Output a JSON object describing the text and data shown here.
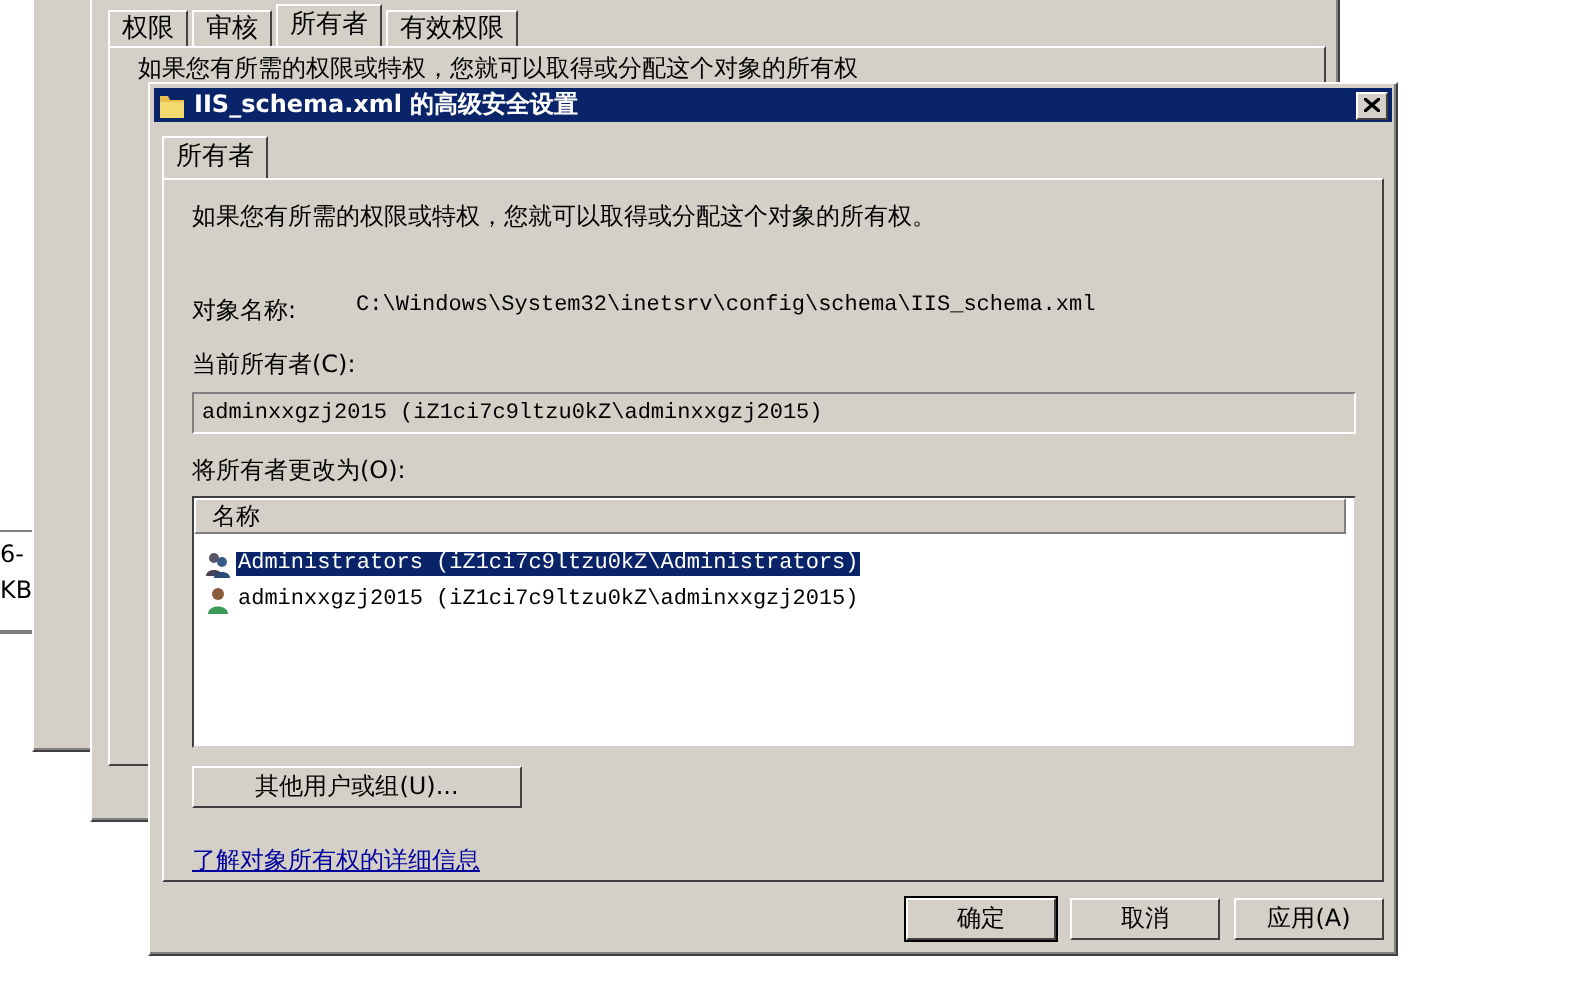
{
  "back_window": {
    "tabs": [
      {
        "label": "权限",
        "selected": false
      },
      {
        "label": "审核",
        "selected": false
      },
      {
        "label": "所有者",
        "selected": true
      },
      {
        "label": "有效权限",
        "selected": false
      }
    ],
    "intro": "如果您有所需的权限或特权，您就可以取得或分配这个对象的所有权"
  },
  "side_fragments": [
    "6-",
    "KB"
  ],
  "dialog": {
    "title": "IIS_schema.xml 的高级安全设置",
    "tabs": [
      {
        "label": "所有者",
        "selected": true
      }
    ],
    "intro": "如果您有所需的权限或特权，您就可以取得或分配这个对象的所有权。",
    "object_label": "对象名称:",
    "object_value": "C:\\Windows\\System32\\inetsrv\\config\\schema\\IIS_schema.xml",
    "current_owner_label": "当前所有者(C):",
    "current_owner": "adminxxgzj2015 (iZ1ci7c9ltzu0kZ\\adminxxgzj2015)",
    "change_label": "将所有者更改为(O):",
    "list": {
      "columns": [
        "名称"
      ],
      "rows": [
        {
          "kind": "group",
          "name": "Administrators (iZ1ci7c9ltzu0kZ\\Administrators)",
          "selected": true
        },
        {
          "kind": "user",
          "name": "adminxxgzj2015 (iZ1ci7c9ltzu0kZ\\adminxxgzj2015)",
          "selected": false
        }
      ]
    },
    "other_button": "其他用户或组(U)...",
    "link": "了解对象所有权的详细信息",
    "buttons": [
      {
        "label": "确定",
        "default": true
      },
      {
        "label": "取消",
        "default": false
      },
      {
        "label": "应用(A)",
        "default": false
      }
    ]
  }
}
